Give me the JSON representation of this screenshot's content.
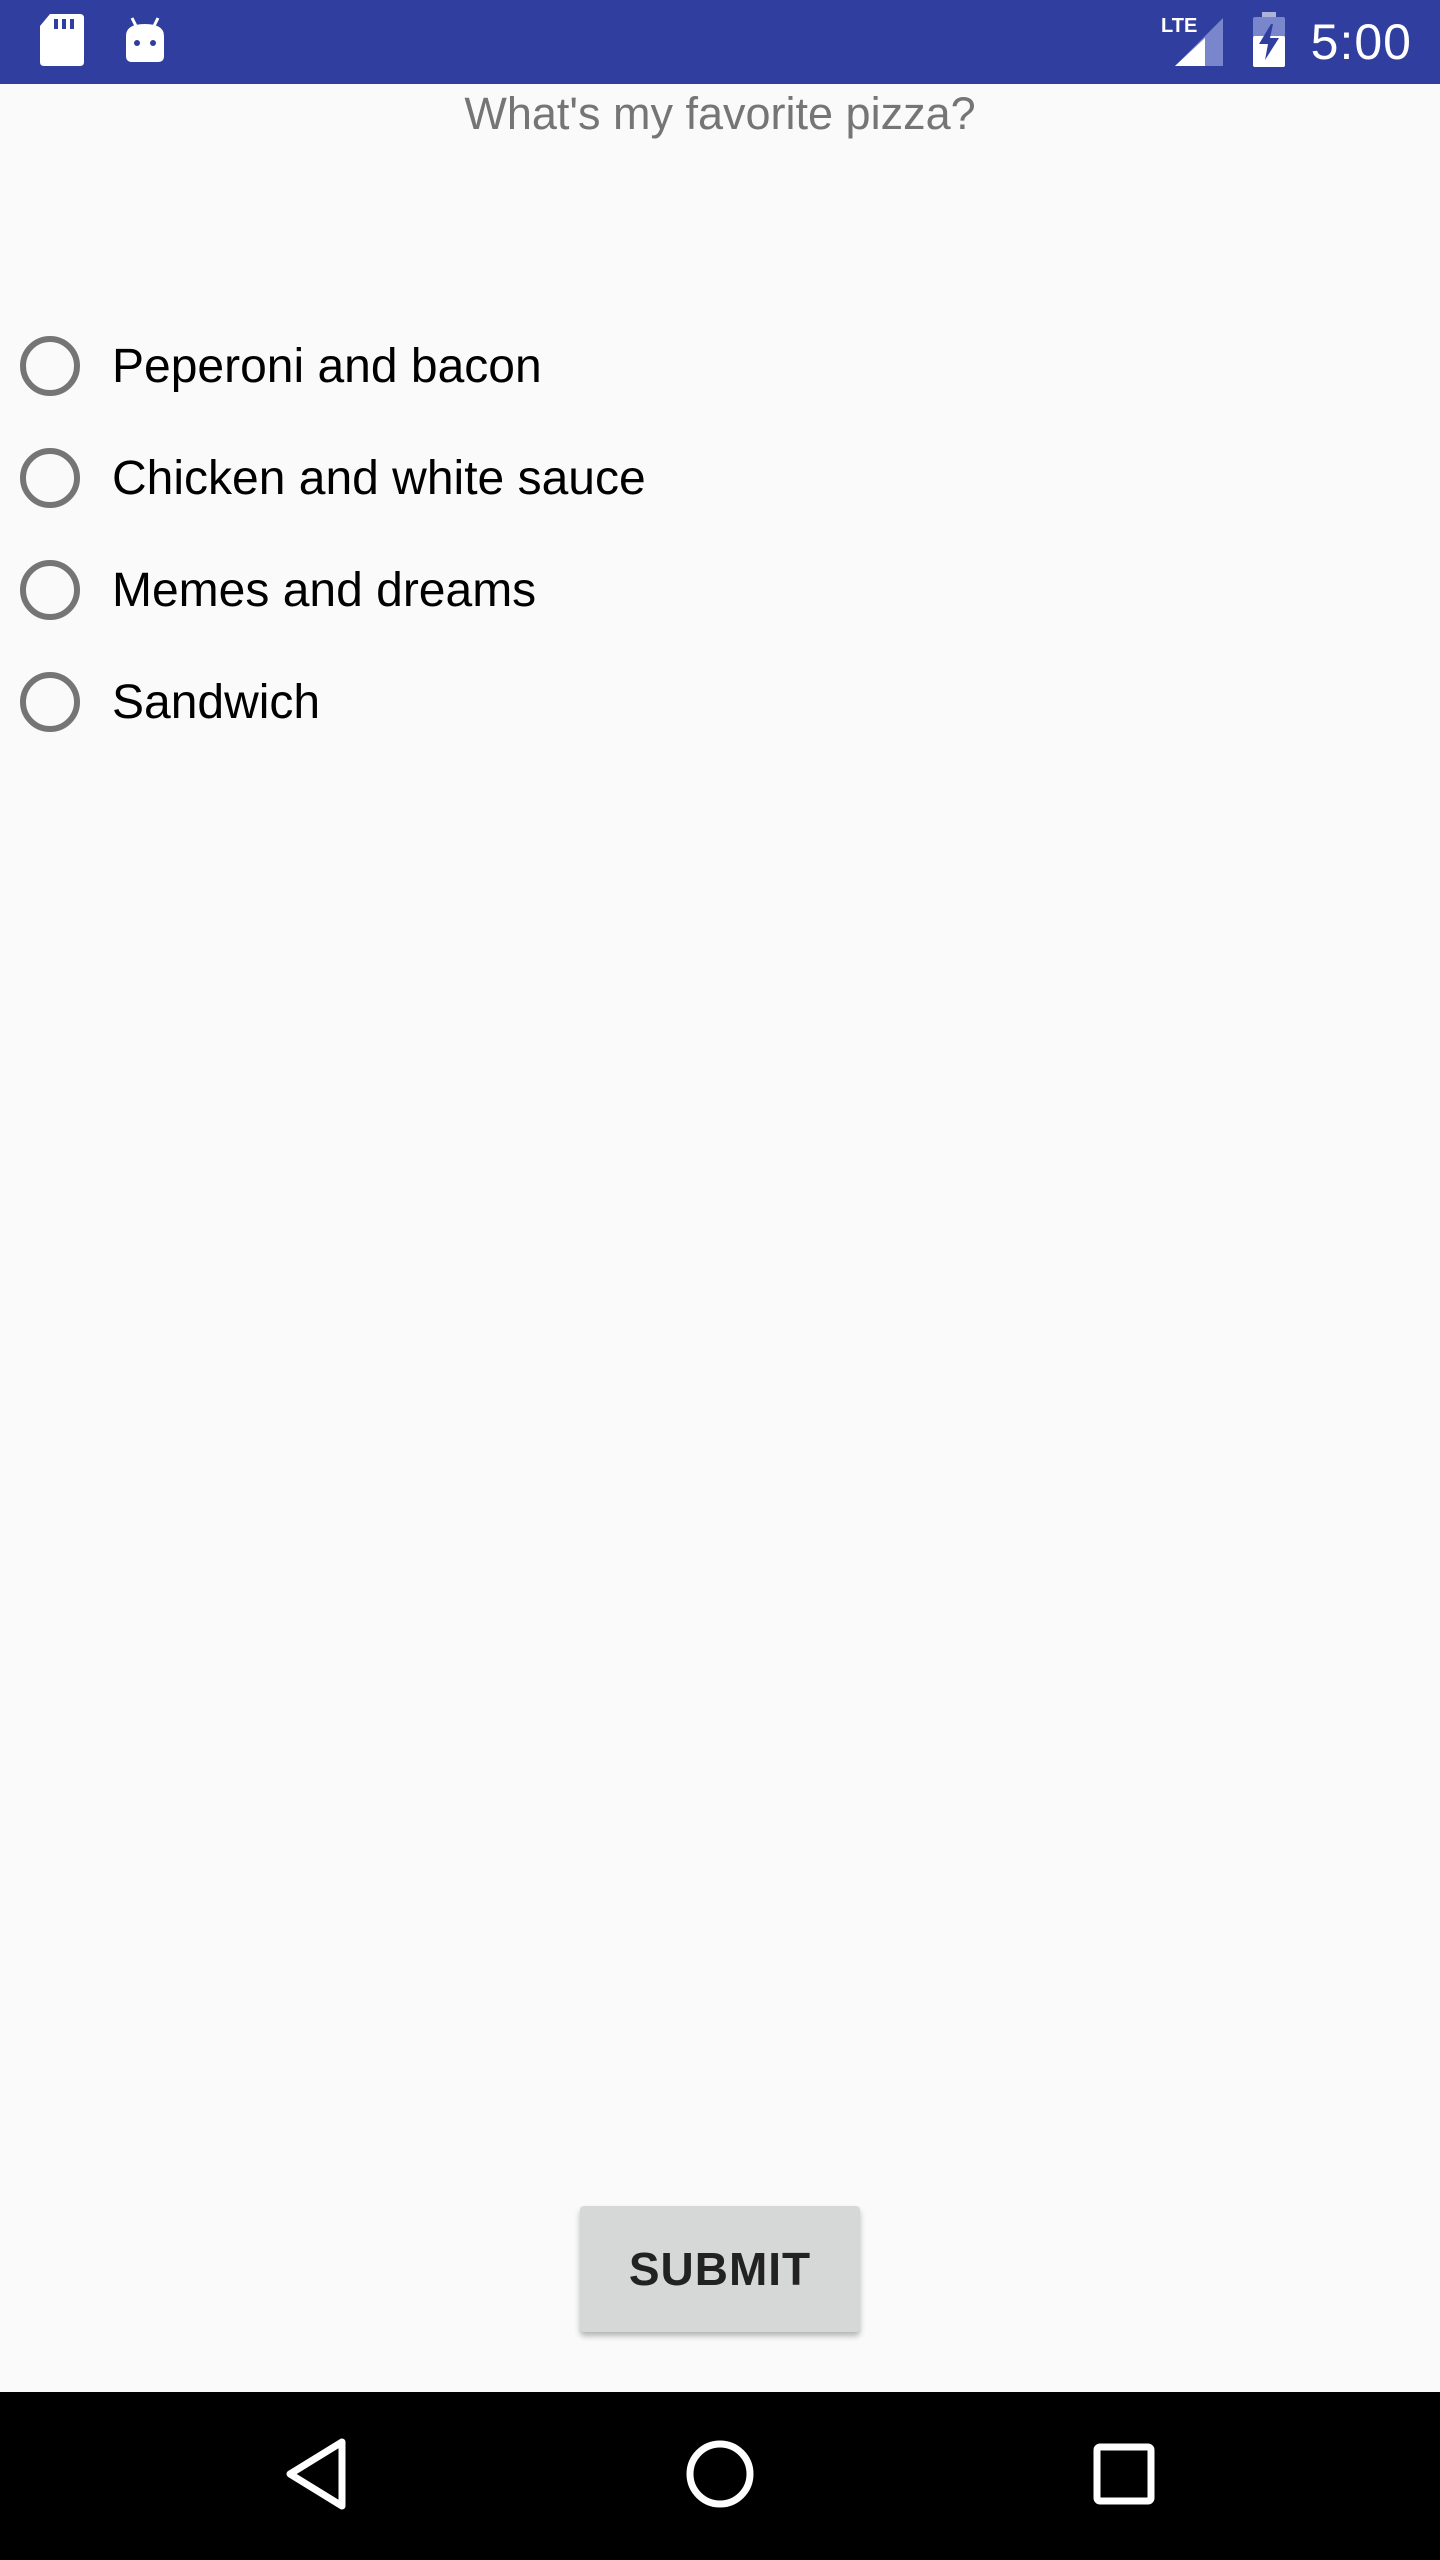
{
  "status_bar": {
    "time": "5:00",
    "network": "LTE",
    "background_color": "#303f9f",
    "left_icons": [
      "sd-card-icon",
      "android-icon"
    ],
    "right_icons": [
      "lte-signal-icon",
      "battery-charging-icon"
    ]
  },
  "question": {
    "text": "What's my favorite pizza?",
    "color": "#757575"
  },
  "options": [
    {
      "label": "Peperoni and bacon",
      "checked": false
    },
    {
      "label": "Chicken and white sauce",
      "checked": false
    },
    {
      "label": "Memes and dreams",
      "checked": false
    },
    {
      "label": "Sandwich",
      "checked": false
    }
  ],
  "submit": {
    "label": "SUBMIT"
  },
  "nav_bar": {
    "icons": [
      "back-icon",
      "home-icon",
      "recents-icon"
    ]
  }
}
